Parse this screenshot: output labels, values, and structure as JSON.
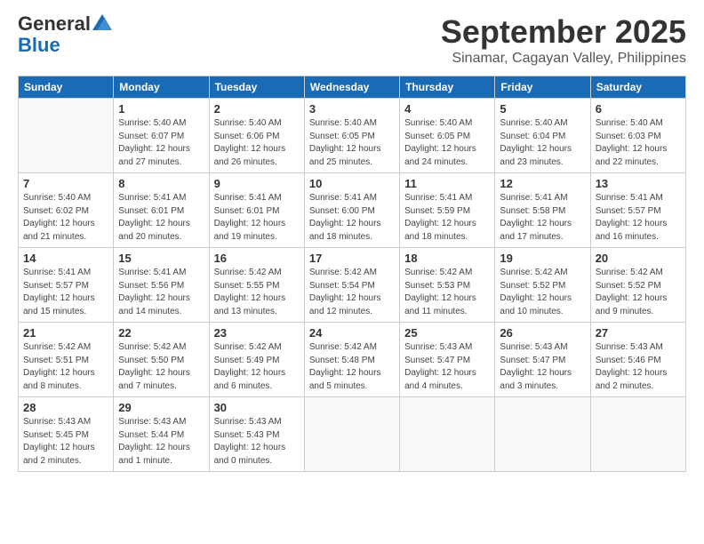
{
  "header": {
    "logo_general": "General",
    "logo_blue": "Blue",
    "month_title": "September 2025",
    "subtitle": "Sinamar, Cagayan Valley, Philippines"
  },
  "weekdays": [
    "Sunday",
    "Monday",
    "Tuesday",
    "Wednesday",
    "Thursday",
    "Friday",
    "Saturday"
  ],
  "weeks": [
    [
      {
        "day": "",
        "info": ""
      },
      {
        "day": "1",
        "info": "Sunrise: 5:40 AM\nSunset: 6:07 PM\nDaylight: 12 hours\nand 27 minutes."
      },
      {
        "day": "2",
        "info": "Sunrise: 5:40 AM\nSunset: 6:06 PM\nDaylight: 12 hours\nand 26 minutes."
      },
      {
        "day": "3",
        "info": "Sunrise: 5:40 AM\nSunset: 6:05 PM\nDaylight: 12 hours\nand 25 minutes."
      },
      {
        "day": "4",
        "info": "Sunrise: 5:40 AM\nSunset: 6:05 PM\nDaylight: 12 hours\nand 24 minutes."
      },
      {
        "day": "5",
        "info": "Sunrise: 5:40 AM\nSunset: 6:04 PM\nDaylight: 12 hours\nand 23 minutes."
      },
      {
        "day": "6",
        "info": "Sunrise: 5:40 AM\nSunset: 6:03 PM\nDaylight: 12 hours\nand 22 minutes."
      }
    ],
    [
      {
        "day": "7",
        "info": "Sunrise: 5:40 AM\nSunset: 6:02 PM\nDaylight: 12 hours\nand 21 minutes."
      },
      {
        "day": "8",
        "info": "Sunrise: 5:41 AM\nSunset: 6:01 PM\nDaylight: 12 hours\nand 20 minutes."
      },
      {
        "day": "9",
        "info": "Sunrise: 5:41 AM\nSunset: 6:01 PM\nDaylight: 12 hours\nand 19 minutes."
      },
      {
        "day": "10",
        "info": "Sunrise: 5:41 AM\nSunset: 6:00 PM\nDaylight: 12 hours\nand 18 minutes."
      },
      {
        "day": "11",
        "info": "Sunrise: 5:41 AM\nSunset: 5:59 PM\nDaylight: 12 hours\nand 18 minutes."
      },
      {
        "day": "12",
        "info": "Sunrise: 5:41 AM\nSunset: 5:58 PM\nDaylight: 12 hours\nand 17 minutes."
      },
      {
        "day": "13",
        "info": "Sunrise: 5:41 AM\nSunset: 5:57 PM\nDaylight: 12 hours\nand 16 minutes."
      }
    ],
    [
      {
        "day": "14",
        "info": "Sunrise: 5:41 AM\nSunset: 5:57 PM\nDaylight: 12 hours\nand 15 minutes."
      },
      {
        "day": "15",
        "info": "Sunrise: 5:41 AM\nSunset: 5:56 PM\nDaylight: 12 hours\nand 14 minutes."
      },
      {
        "day": "16",
        "info": "Sunrise: 5:42 AM\nSunset: 5:55 PM\nDaylight: 12 hours\nand 13 minutes."
      },
      {
        "day": "17",
        "info": "Sunrise: 5:42 AM\nSunset: 5:54 PM\nDaylight: 12 hours\nand 12 minutes."
      },
      {
        "day": "18",
        "info": "Sunrise: 5:42 AM\nSunset: 5:53 PM\nDaylight: 12 hours\nand 11 minutes."
      },
      {
        "day": "19",
        "info": "Sunrise: 5:42 AM\nSunset: 5:52 PM\nDaylight: 12 hours\nand 10 minutes."
      },
      {
        "day": "20",
        "info": "Sunrise: 5:42 AM\nSunset: 5:52 PM\nDaylight: 12 hours\nand 9 minutes."
      }
    ],
    [
      {
        "day": "21",
        "info": "Sunrise: 5:42 AM\nSunset: 5:51 PM\nDaylight: 12 hours\nand 8 minutes."
      },
      {
        "day": "22",
        "info": "Sunrise: 5:42 AM\nSunset: 5:50 PM\nDaylight: 12 hours\nand 7 minutes."
      },
      {
        "day": "23",
        "info": "Sunrise: 5:42 AM\nSunset: 5:49 PM\nDaylight: 12 hours\nand 6 minutes."
      },
      {
        "day": "24",
        "info": "Sunrise: 5:42 AM\nSunset: 5:48 PM\nDaylight: 12 hours\nand 5 minutes."
      },
      {
        "day": "25",
        "info": "Sunrise: 5:43 AM\nSunset: 5:47 PM\nDaylight: 12 hours\nand 4 minutes."
      },
      {
        "day": "26",
        "info": "Sunrise: 5:43 AM\nSunset: 5:47 PM\nDaylight: 12 hours\nand 3 minutes."
      },
      {
        "day": "27",
        "info": "Sunrise: 5:43 AM\nSunset: 5:46 PM\nDaylight: 12 hours\nand 2 minutes."
      }
    ],
    [
      {
        "day": "28",
        "info": "Sunrise: 5:43 AM\nSunset: 5:45 PM\nDaylight: 12 hours\nand 2 minutes."
      },
      {
        "day": "29",
        "info": "Sunrise: 5:43 AM\nSunset: 5:44 PM\nDaylight: 12 hours\nand 1 minute."
      },
      {
        "day": "30",
        "info": "Sunrise: 5:43 AM\nSunset: 5:43 PM\nDaylight: 12 hours\nand 0 minutes."
      },
      {
        "day": "",
        "info": ""
      },
      {
        "day": "",
        "info": ""
      },
      {
        "day": "",
        "info": ""
      },
      {
        "day": "",
        "info": ""
      }
    ]
  ]
}
